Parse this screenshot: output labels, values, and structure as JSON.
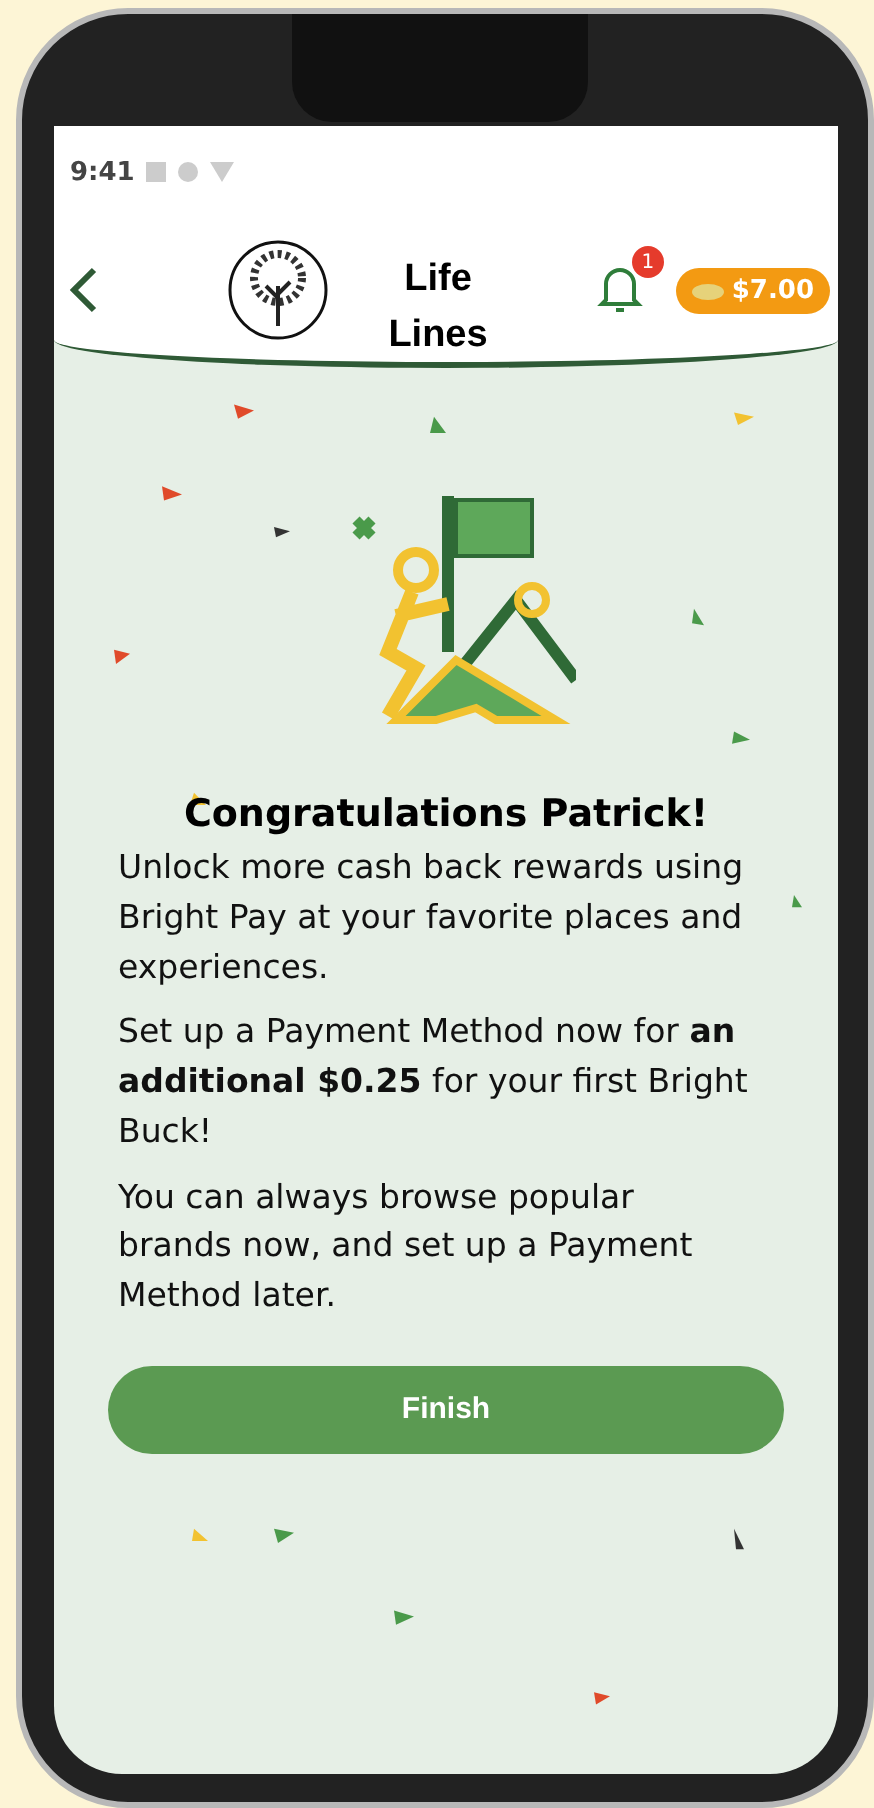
{
  "status_bar": {
    "time": "9:41"
  },
  "header": {
    "title": "Life Lines",
    "notification_badge": "1",
    "balance": "$7.00"
  },
  "content": {
    "heading": "Congratulations Patrick!",
    "paragraphs": [
      "Unlock more cash back rewards using Bright Pay at your favorite places and experiences.",
      "Set up a Payment Method now for **an additional $0.25** for your first Bright Buck!",
      "You can always browse popular brands now, and set up a Payment Method later."
    ],
    "button": "Finish"
  }
}
